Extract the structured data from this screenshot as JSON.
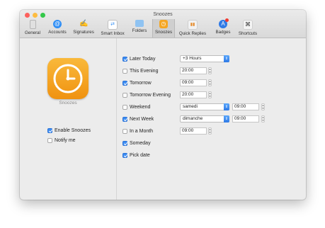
{
  "window": {
    "title": "Snoozes"
  },
  "colors": {
    "close": "#fc615d",
    "minimize": "#fdbc40",
    "zoom": "#34c84a",
    "accent": "#3c8df3",
    "app_icon": "#f5a623"
  },
  "tabs": [
    {
      "label": "General",
      "icon": "switch-icon"
    },
    {
      "label": "Accounts",
      "icon": "at-sign-icon"
    },
    {
      "label": "Signatures",
      "icon": "signature-icon"
    },
    {
      "label": "Smart Inbox",
      "icon": "smart-inbox-icon"
    },
    {
      "label": "Folders",
      "icon": "folder-icon"
    },
    {
      "label": "Snoozes",
      "icon": "clock-icon",
      "selected": true
    },
    {
      "label": "Quick Replies",
      "icon": "quick-replies-icon"
    },
    {
      "label": "Badges",
      "icon": "badge-icon"
    },
    {
      "label": "Shortcuts",
      "icon": "command-icon"
    }
  ],
  "left": {
    "app_name": "Snoozes",
    "enable_label": "Enable Snoozes",
    "enable_checked": true,
    "notify_label": "Notify me",
    "notify_checked": false
  },
  "options": [
    {
      "label": "Later Today",
      "checked": true,
      "popup": "+3 Hours"
    },
    {
      "label": "This Evening",
      "checked": false,
      "time": "20:00"
    },
    {
      "label": "Tomorrow",
      "checked": true,
      "time": "09:00"
    },
    {
      "label": "Tomorrow Evening",
      "checked": false,
      "time": "20:00"
    },
    {
      "label": "Weekend",
      "checked": false,
      "popup": "samedi",
      "time2": "09:00"
    },
    {
      "label": "Next Week",
      "checked": true,
      "popup": "dimanche",
      "time2": "09:00"
    },
    {
      "label": "In a Month",
      "checked": false,
      "time": "09:00"
    },
    {
      "label": "Someday",
      "checked": true
    },
    {
      "label": "Pick date",
      "checked": true
    }
  ]
}
